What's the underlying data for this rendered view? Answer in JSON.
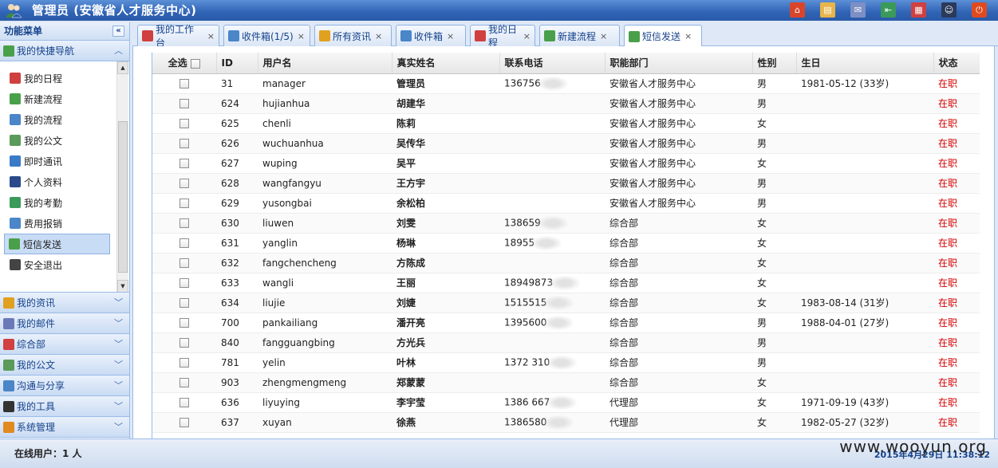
{
  "header": {
    "title": "管理员 (安徽省人才服务中心)",
    "tools": [
      "home-icon",
      "clipboard-icon",
      "mail-icon",
      "exit-door-icon",
      "calendar-icon",
      "user-icon",
      "power-icon"
    ],
    "colors": {
      "bar": "#2f63b5"
    }
  },
  "leftnav": {
    "title": "功能菜单",
    "collapse_label": "«",
    "quicknav_label": "我的快捷导航",
    "items": [
      {
        "label": "我的日程",
        "icon": "calendar-icon",
        "color": "#d04040"
      },
      {
        "label": "新建流程",
        "icon": "new-flow-icon",
        "color": "#4aa04a"
      },
      {
        "label": "我的流程",
        "icon": "flow-icon",
        "color": "#4a86c8"
      },
      {
        "label": "我的公文",
        "icon": "document-icon",
        "color": "#5a9a5a"
      },
      {
        "label": "即时通讯",
        "icon": "chat-icon",
        "color": "#3a7ac8"
      },
      {
        "label": "个人资料",
        "icon": "person-icon",
        "color": "#2a4a8a"
      },
      {
        "label": "我的考勤",
        "icon": "attendance-icon",
        "color": "#3a9a5a"
      },
      {
        "label": "费用报销",
        "icon": "expense-icon",
        "color": "#4a86c8"
      },
      {
        "label": "短信发送",
        "icon": "sms-icon",
        "color": "#4aa04a",
        "active": true
      },
      {
        "label": "安全退出",
        "icon": "logout-icon",
        "color": "#444444"
      }
    ],
    "sections": [
      {
        "label": "我的资讯",
        "icon": "news-icon",
        "color": "#e0a020"
      },
      {
        "label": "我的邮件",
        "icon": "mail-icon",
        "color": "#6a7ab8"
      },
      {
        "label": "综合部",
        "icon": "calendar-icon",
        "color": "#d04040"
      },
      {
        "label": "我的公文",
        "icon": "document-icon",
        "color": "#5a9a5a"
      },
      {
        "label": "沟通与分享",
        "icon": "share-icon",
        "color": "#4a86c8"
      },
      {
        "label": "我的工具",
        "icon": "tool-icon",
        "color": "#333333"
      },
      {
        "label": "系统管理",
        "icon": "system-icon",
        "color": "#e08a20"
      }
    ]
  },
  "tabs": [
    {
      "label": "我的工作台",
      "icon": "home-icon",
      "color": "#d04040"
    },
    {
      "label": "收件箱(1/5)",
      "icon": "inbox-icon",
      "color": "#4a86c8"
    },
    {
      "label": "所有资讯",
      "icon": "news-icon",
      "color": "#e0a020"
    },
    {
      "label": "收件箱",
      "icon": "inbox-icon",
      "color": "#4a86c8"
    },
    {
      "label": "我的日程",
      "icon": "calendar-icon",
      "color": "#d04040"
    },
    {
      "label": "新建流程",
      "icon": "new-flow-icon",
      "color": "#4aa04a"
    },
    {
      "label": "短信发送",
      "icon": "sms-icon",
      "color": "#4aa04a",
      "active": true
    }
  ],
  "tab_close": "×",
  "table": {
    "columns": [
      "全选",
      "ID",
      "用户名",
      "真实姓名",
      "联系电话",
      "职能部门",
      "性别",
      "生日",
      "状态"
    ],
    "rows": [
      [
        "31",
        "manager",
        "管理员",
        "136756",
        "安徽省人才服务中心",
        "男",
        "1981-05-12 (33岁)",
        "在职"
      ],
      [
        "624",
        "hujianhua",
        "胡建华",
        "",
        "安徽省人才服务中心",
        "男",
        "",
        "在职"
      ],
      [
        "625",
        "chenli",
        "陈莉",
        "",
        "安徽省人才服务中心",
        "女",
        "",
        "在职"
      ],
      [
        "626",
        "wuchuanhua",
        "吴传华",
        "",
        "安徽省人才服务中心",
        "男",
        "",
        "在职"
      ],
      [
        "627",
        "wuping",
        "吴平",
        "",
        "安徽省人才服务中心",
        "女",
        "",
        "在职"
      ],
      [
        "628",
        "wangfangyu",
        "王方宇",
        "",
        "安徽省人才服务中心",
        "男",
        "",
        "在职"
      ],
      [
        "629",
        "yusongbai",
        "余松柏",
        "",
        "安徽省人才服务中心",
        "男",
        "",
        "在职"
      ],
      [
        "630",
        "liuwen",
        "刘雯",
        "138659",
        "综合部",
        "女",
        "",
        "在职"
      ],
      [
        "631",
        "yanglin",
        "杨琳",
        "18955",
        "综合部",
        "女",
        "",
        "在职"
      ],
      [
        "632",
        "fangchencheng",
        "方陈成",
        "",
        "综合部",
        "女",
        "",
        "在职"
      ],
      [
        "633",
        "wangli",
        "王丽",
        "18949873",
        "综合部",
        "女",
        "",
        "在职"
      ],
      [
        "634",
        "liujie",
        "刘婕",
        "1515515",
        "综合部",
        "女",
        "1983-08-14 (31岁)",
        "在职"
      ],
      [
        "700",
        "pankailiang",
        "潘开亮",
        "1395600",
        "综合部",
        "男",
        "1988-04-01 (27岁)",
        "在职"
      ],
      [
        "840",
        "fangguangbing",
        "方光兵",
        "",
        "综合部",
        "男",
        "",
        "在职"
      ],
      [
        "781",
        "yelin",
        "叶林",
        "1372      310",
        "综合部",
        "男",
        "",
        "在职"
      ],
      [
        "903",
        "zhengmengmeng",
        "郑蒙蒙",
        "",
        "综合部",
        "女",
        "",
        "在职"
      ],
      [
        "636",
        "liyuying",
        "李宇莹",
        "1386      667",
        "代理部",
        "女",
        "1971-09-19 (43岁)",
        "在职"
      ],
      [
        "637",
        "xuyan",
        "徐燕",
        "1386580",
        "代理部",
        "女",
        "1982-05-27 (32岁)",
        "在职"
      ]
    ]
  },
  "footer": {
    "online": "在线用户：1 人",
    "clock": "2015年4月29日 11:38:12",
    "watermark": "www.wooyun.org"
  }
}
